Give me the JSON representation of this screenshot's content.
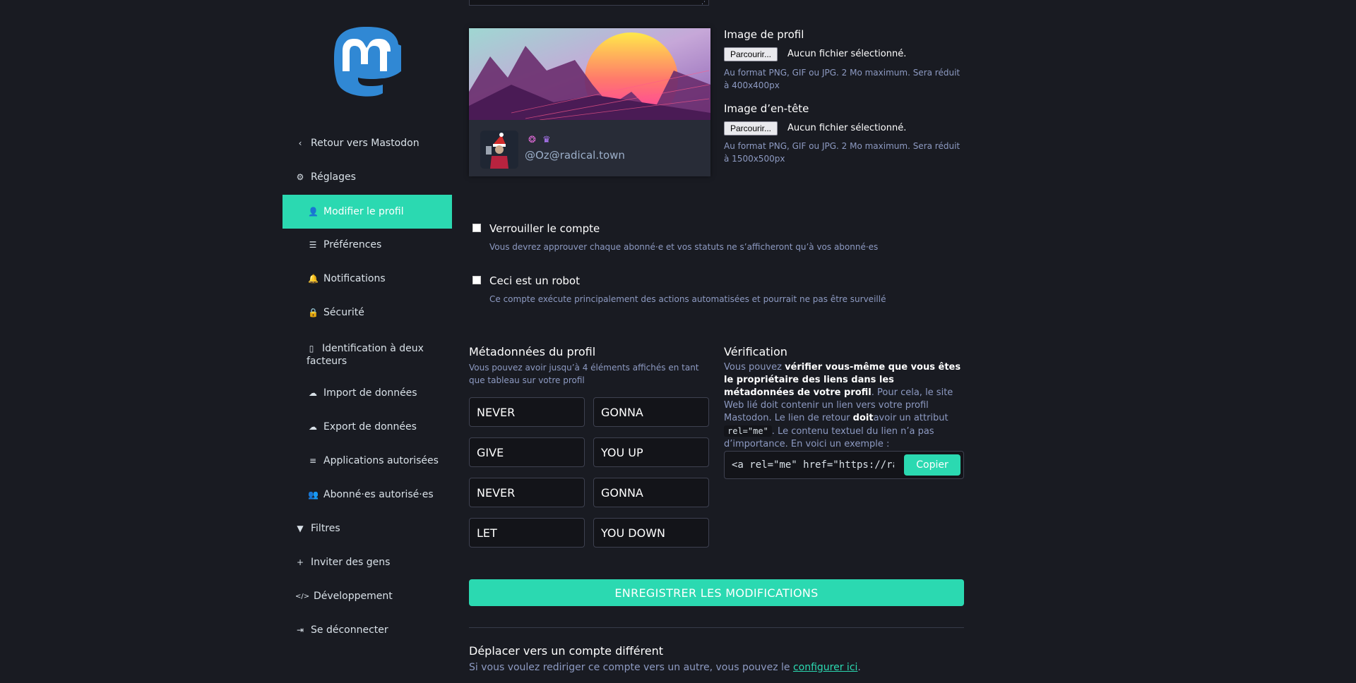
{
  "sidebar": {
    "items": [
      {
        "label": "Retour vers Mastodon",
        "icon": "chevron-left-icon",
        "glyph": "‹"
      },
      {
        "label": "Réglages",
        "icon": "gear-icon",
        "glyph": "⚙"
      },
      {
        "label": "Modifier le profil",
        "icon": "user-icon",
        "glyph": "👤"
      },
      {
        "label": "Préférences",
        "icon": "sliders-icon",
        "glyph": "☰"
      },
      {
        "label": "Notifications",
        "icon": "bell-icon",
        "glyph": "🔔"
      },
      {
        "label": "Sécurité",
        "icon": "lock-icon",
        "glyph": "🔒"
      },
      {
        "label": "Identification à deux facteurs",
        "icon": "mobile-icon",
        "glyph": "▯"
      },
      {
        "label": "Import de données",
        "icon": "cloud-upload-icon",
        "glyph": "☁"
      },
      {
        "label": "Export de données",
        "icon": "cloud-download-icon",
        "glyph": "☁"
      },
      {
        "label": "Applications autorisées",
        "icon": "list-icon",
        "glyph": "≡"
      },
      {
        "label": "Abonné·es autorisé·es",
        "icon": "users-icon",
        "glyph": "👥"
      },
      {
        "label": "Filtres",
        "icon": "filter-icon",
        "glyph": "▼"
      },
      {
        "label": "Inviter des gens",
        "icon": "user-plus-icon",
        "glyph": "+"
      },
      {
        "label": "Développement",
        "icon": "code-icon",
        "glyph": "</>"
      },
      {
        "label": "Se déconnecter",
        "icon": "sign-out-icon",
        "glyph": "⇥"
      }
    ]
  },
  "profile_card": {
    "handle": "@Oz@radical.town",
    "emoji1": "❂",
    "emoji2": "♛"
  },
  "avatar_upload": {
    "label": "Image de profil",
    "button": "Parcourir...",
    "status": "Aucun fichier sélectionné.",
    "hint": "Au format PNG, GIF ou JPG. 2 Mo maximum. Sera réduit à 400x400px"
  },
  "header_upload": {
    "label": "Image d’en-tête",
    "button": "Parcourir...",
    "status": "Aucun fichier sélectionné.",
    "hint": "Au format PNG, GIF ou JPG. 2 Mo maximum. Sera réduit à 1500x500px"
  },
  "lock_account": {
    "label": "Verrouiller le compte",
    "hint": "Vous devrez approuver chaque abonné·e et vos statuts ne s’afficheront qu’à vos abonné·es"
  },
  "bot_account": {
    "label": "Ceci est un robot",
    "hint": "Ce compte exécute principalement des actions automatisées et pourrait ne pas être surveillé"
  },
  "metadata": {
    "title": "Métadonnées du profil",
    "hint": "Vous pouvez avoir jusqu’à 4 éléments affichés en tant que tableau sur votre profil",
    "rows": [
      {
        "name": "NEVER",
        "value": "GONNA"
      },
      {
        "name": "GIVE",
        "value": "YOU UP"
      },
      {
        "name": "NEVER",
        "value": "GONNA"
      },
      {
        "name": "LET",
        "value": "YOU DOWN"
      }
    ]
  },
  "verification": {
    "title": "Vérification",
    "p1": "Vous pouvez ",
    "p1_bold": "vérifier vous-même que vous êtes le propriétaire des liens dans les métadonnées de votre profil",
    "p2": ". Pour cela, le site Web lié doit contenir un lien vers votre profil Mastodon. Le lien de retour ",
    "p2_bold": "doit",
    "p3": "avoir un attribut ",
    "code": "rel=\"me\"",
    "p4": ". Le contenu textuel du lien n’a pas d’importance. En voici un exemple :",
    "link_code": "<a rel=\"me\" href=\"https://radical.town/@Oz\">Mastodon</a>",
    "copy_button": "Copier"
  },
  "save_button": "ENREGISTRER LES MODIFICATIONS",
  "move": {
    "title": "Déplacer vers un compte différent",
    "text": "Si vous voulez rediriger ce compte vers un autre, vous pouvez le ",
    "link": "configurer ici",
    "end": "."
  },
  "colors": {
    "accent": "#2bd9b1",
    "background": "#191b22",
    "card": "#282c37"
  }
}
